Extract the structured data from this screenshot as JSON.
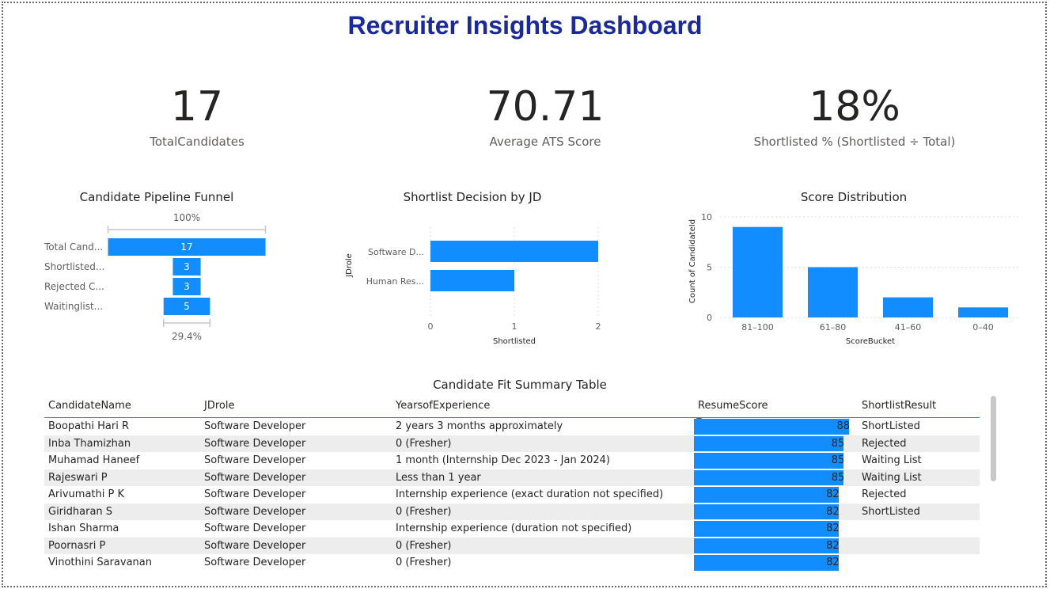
{
  "title": "Recruiter Insights Dashboard",
  "kpis": [
    {
      "value": "17",
      "label": "TotalCandidates"
    },
    {
      "value": "70.71",
      "label": "Average ATS Score"
    },
    {
      "value": "18%",
      "label": "Shortlisted % (Shortlisted ÷ Total)"
    }
  ],
  "colors": {
    "bar": "#118dff",
    "title": "#1a2a9c",
    "header_rule": "#2f7fd1"
  },
  "chart_data": [
    {
      "type": "bar",
      "orientation": "funnel",
      "title": "Candidate Pipeline Funnel",
      "categories": [
        "Total Cand...",
        "Shortlisted...",
        "Rejected C...",
        "Waitinglist..."
      ],
      "values": [
        17,
        3,
        3,
        5
      ],
      "top_label": "100%",
      "bottom_label": "29.4%"
    },
    {
      "type": "bar",
      "orientation": "horizontal",
      "title": "Shortlist Decision by JD",
      "categories": [
        "Software D...",
        "Human Res..."
      ],
      "values": [
        2,
        1
      ],
      "xlabel": "Shortlisted",
      "ylabel": "JDrole",
      "xlim": [
        0,
        2
      ],
      "xticks": [
        "0",
        "1",
        "2"
      ],
      "grid": true
    },
    {
      "type": "bar",
      "title": "Score Distribution",
      "categories": [
        "81–100",
        "61–80",
        "41–60",
        "0–40"
      ],
      "values": [
        9,
        5,
        2,
        1
      ],
      "xlabel": "ScoreBucket",
      "ylabel": "Count of CandidateId",
      "ylim": [
        0,
        10
      ],
      "yticks": [
        "0",
        "5",
        "10"
      ],
      "grid": true
    }
  ],
  "table": {
    "title": "Candidate Fit Summary Table",
    "columns": [
      "CandidateName",
      "JDrole",
      "YearsofExperience",
      "ResumeScore",
      "ShortlistResult"
    ],
    "score_max": 88,
    "rows": [
      {
        "name": "Boopathi Hari R",
        "role": "Software Developer",
        "exp": "2 years 3 months approximately",
        "score": "88",
        "result": "ShortListed"
      },
      {
        "name": "Inba Thamizhan",
        "role": "Software Developer",
        "exp": "0 (Fresher)",
        "score": "85",
        "result": "Rejected"
      },
      {
        "name": "Muhamad Haneef",
        "role": "Software Developer",
        "exp": "1 month (Internship Dec 2023 - Jan 2024)",
        "score": "85",
        "result": "Waiting List"
      },
      {
        "name": "Rajeswari P",
        "role": "Software Developer",
        "exp": "Less than 1 year",
        "score": "85",
        "result": "Waiting List"
      },
      {
        "name": "Arivumathi P K",
        "role": "Software Developer",
        "exp": "Internship experience (exact duration not specified)",
        "score": "82",
        "result": "Rejected"
      },
      {
        "name": "Giridharan S",
        "role": "Software Developer",
        "exp": "0 (Fresher)",
        "score": "82",
        "result": "ShortListed"
      },
      {
        "name": "Ishan Sharma",
        "role": "Software Developer",
        "exp": "Internship experience (duration not specified)",
        "score": "82",
        "result": ""
      },
      {
        "name": "Poornasri P",
        "role": "Software Developer",
        "exp": "0 (Fresher)",
        "score": "82",
        "result": ""
      },
      {
        "name": "Vinothini Saravanan",
        "role": "Software Developer",
        "exp": "0 (Fresher)",
        "score": "82",
        "result": ""
      }
    ]
  }
}
